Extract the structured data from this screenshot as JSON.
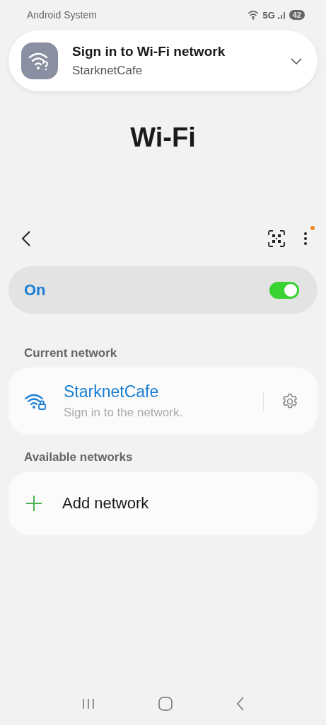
{
  "status_bar": {
    "app": "Android System",
    "network": "5G",
    "battery": "42"
  },
  "notification": {
    "title": "Sign in to Wi-Fi network",
    "subtitle": "StarknetCafe",
    "expanded": false
  },
  "title": "Wi-Fi",
  "toolbar": {
    "menu_badge": true
  },
  "master_switch": {
    "label": "On",
    "on": true
  },
  "sections": [
    {
      "heading": "Current network",
      "items": [
        {
          "kind": "network",
          "name": "StarknetCafe",
          "status": "Sign in to the network."
        }
      ]
    },
    {
      "heading": "Available networks",
      "items": [
        {
          "kind": "add",
          "name": "Add network"
        }
      ]
    }
  ]
}
